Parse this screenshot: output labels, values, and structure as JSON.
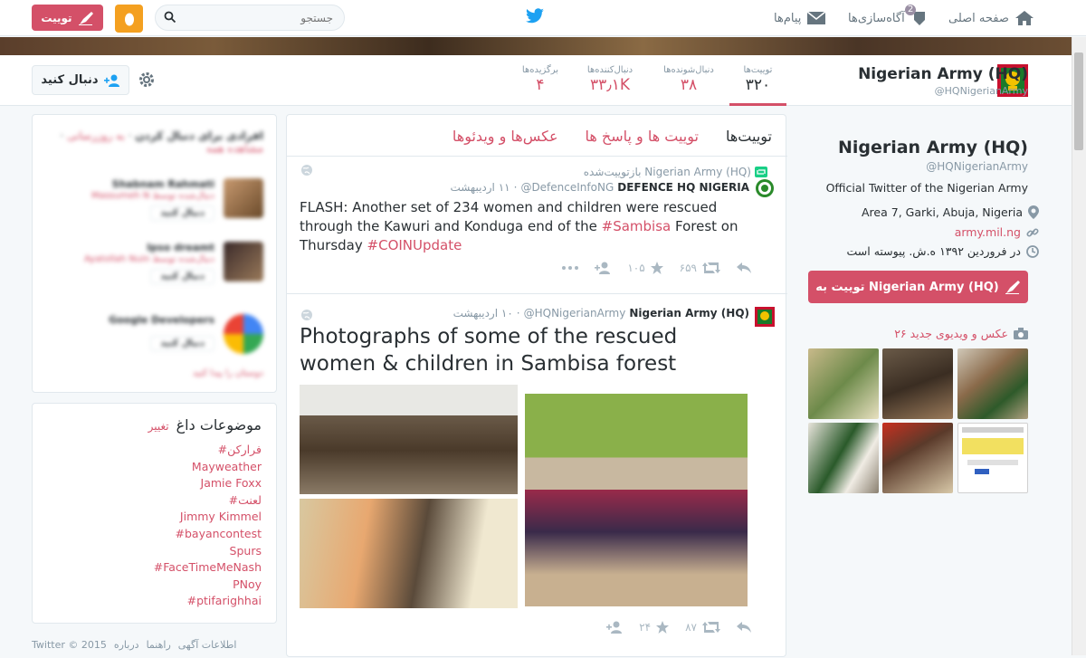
{
  "topnav": {
    "home": "صفحه اصلی",
    "notifications": "آگاه‌سازی‌ها",
    "notifications_count": "2",
    "messages": "پیام‌ها",
    "search_placeholder": "جستجو",
    "tweet_button": "توییت"
  },
  "profile_nav": {
    "name": "Nigerian Army (HQ)",
    "handle": "@HQNigerianArmy",
    "stats": [
      {
        "label": "توییت‌ها",
        "value": "۳۲۰"
      },
      {
        "label": "دنبال‌شونده‌ها",
        "value": "۳۸"
      },
      {
        "label": "دنبال‌کننده‌ها",
        "value": "۳۳٫۱K"
      },
      {
        "label": "برگزیده‌ها",
        "value": "۴"
      }
    ],
    "follow_button": "دنبال کنید"
  },
  "profile_card": {
    "name": "Nigerian Army (HQ)",
    "handle": "@HQNigerianArmy",
    "bio": "Official Twitter of the Nigerian Army",
    "location": "Area 7, Garki, Abuja, Nigeria",
    "website": "army.mil.ng",
    "joined": "در فروردین ۱۳۹۲ ه.ش. پیوسته است",
    "tweet_to_button": "توییت به Nigerian Army (HQ)",
    "media_link": "۲۶ عکس و ویدیوی جدید"
  },
  "stream": {
    "tabs": [
      "توییت‌ها",
      "توییت ها و پاسخ ها",
      "عکس‌ها و ویدئوها"
    ],
    "tweets": [
      {
        "retweet_label": "Nigerian Army (HQ) بازتوییت‌شده",
        "name": "DEFENCE HQ NIGERIA",
        "handle": "@DefenceInfoNG",
        "time": "۱۱ اردیبهشت",
        "text_parts": [
          "FLASH: Another set of 234 women and children were rescued through the Kawuri and Konduga end of the ",
          "#Sambisa",
          " Forest on Thursday ",
          "#COINUpdate"
        ],
        "retweets": "۶۵۹",
        "favorites": "۱۰۵"
      },
      {
        "name": "Nigerian Army (HQ)",
        "handle": "@HQNigerianArmy",
        "time": "۱۰ اردیبهشت",
        "text": "Photographs of some of the rescued women & children in Sambisa forest",
        "retweets": "۸۷",
        "favorites": "۲۴"
      }
    ]
  },
  "who_to_follow": {
    "title": "افرادی برای دنبال کردن",
    "refresh": "به روزرسانی",
    "view_all": "مشاهده همه",
    "users": [
      {
        "name": "Shabnam Rahmati",
        "sub": "دنبال‌شده توسط Massumeh N",
        "follow": "دنبال کنید"
      },
      {
        "name": "Ipso dreamt",
        "sub": "دنبال‌شده توسط Ayatollah Nuin",
        "follow": "دنبال کنید"
      },
      {
        "name": "Google Developers",
        "sub": "",
        "follow": "دنبال کنید"
      }
    ],
    "find_friends": "دوستان را پیدا کنید"
  },
  "trends": {
    "title": "موضوعات داغ",
    "change": "تغییر",
    "items": [
      "#فرارکن",
      "Mayweather",
      "Jamie Foxx",
      "#لعنت",
      "Jimmy Kimmel",
      "#bayancontest",
      "Spurs",
      "#FaceTimeMeNash",
      "PNoy",
      "#ptifarighhai"
    ]
  },
  "footer": [
    "Twitter © 2015",
    "درباره",
    "راهنما",
    "اطلاعات آگهی"
  ],
  "colors": {
    "accent": "#d45068",
    "twitter_blue": "#1da1f2"
  }
}
